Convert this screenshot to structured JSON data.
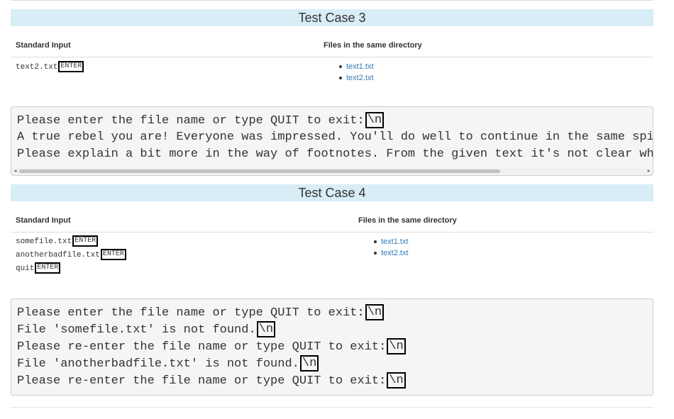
{
  "cases": [
    {
      "title": "Test Case 3",
      "standard_input_header": "Standard Input",
      "files_header": "Files in the same directory",
      "inputs": [
        {
          "text": "text2.txt",
          "key": "ENTER"
        }
      ],
      "files": [
        "text1.txt",
        "text2.txt"
      ],
      "output_lines": [
        {
          "text": "Please enter the file name or type QUIT to exit:",
          "newline": "\\n"
        },
        {
          "text": "A true rebel you are! Everyone was impressed. You'll do well to continue in the same spi"
        },
        {
          "text": "Please explain a bit more in the way of footnotes. From the given text it's not clear wh"
        }
      ]
    },
    {
      "title": "Test Case 4",
      "standard_input_header": "Standard Input",
      "files_header": "Files in the same directory",
      "inputs": [
        {
          "text": "somefile.txt",
          "key": "ENTER"
        },
        {
          "text": "anotherbadfile.txt",
          "key": "ENTER"
        },
        {
          "text": "quit",
          "key": "ENTER"
        }
      ],
      "files": [
        "text1.txt",
        "text2.txt"
      ],
      "output_lines": [
        {
          "text": "Please enter the file name or type QUIT to exit:",
          "newline": "\\n"
        },
        {
          "text": "File 'somefile.txt' is not found.",
          "newline": "\\n"
        },
        {
          "text": "Please re-enter the file name or type QUIT to exit:",
          "newline": "\\n"
        },
        {
          "text": "File 'anotherbadfile.txt' is not found.",
          "newline": "\\n"
        },
        {
          "text": "Please re-enter the file name or type QUIT to exit:",
          "newline": "\\n"
        }
      ]
    }
  ],
  "colors": {
    "header_bg": "#d9edf7",
    "link": "#337ab7",
    "output_bg": "#f5f5f5"
  }
}
